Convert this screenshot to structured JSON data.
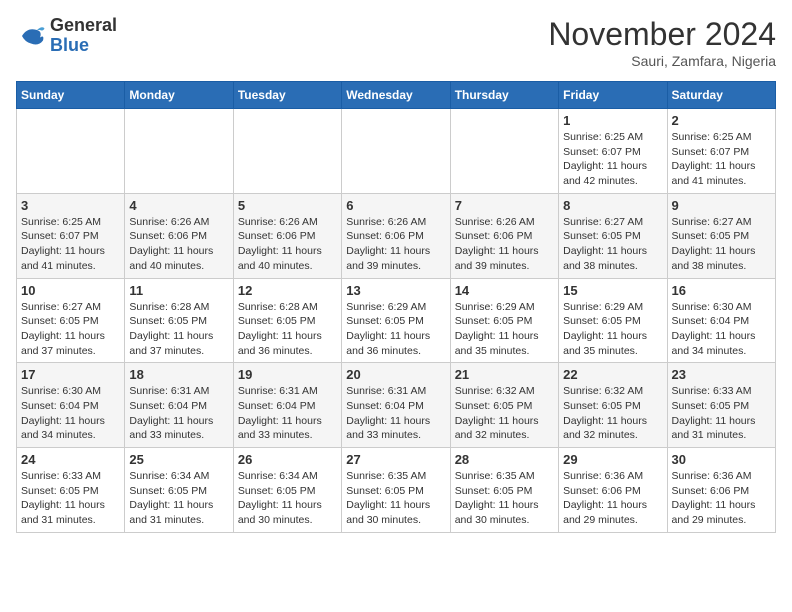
{
  "logo": {
    "general": "General",
    "blue": "Blue"
  },
  "title": {
    "month_year": "November 2024",
    "location": "Sauri, Zamfara, Nigeria"
  },
  "weekdays": [
    "Sunday",
    "Monday",
    "Tuesday",
    "Wednesday",
    "Thursday",
    "Friday",
    "Saturday"
  ],
  "weeks": [
    [
      {
        "day": "",
        "info": ""
      },
      {
        "day": "",
        "info": ""
      },
      {
        "day": "",
        "info": ""
      },
      {
        "day": "",
        "info": ""
      },
      {
        "day": "",
        "info": ""
      },
      {
        "day": "1",
        "info": "Sunrise: 6:25 AM\nSunset: 6:07 PM\nDaylight: 11 hours and 42 minutes."
      },
      {
        "day": "2",
        "info": "Sunrise: 6:25 AM\nSunset: 6:07 PM\nDaylight: 11 hours and 41 minutes."
      }
    ],
    [
      {
        "day": "3",
        "info": "Sunrise: 6:25 AM\nSunset: 6:07 PM\nDaylight: 11 hours and 41 minutes."
      },
      {
        "day": "4",
        "info": "Sunrise: 6:26 AM\nSunset: 6:06 PM\nDaylight: 11 hours and 40 minutes."
      },
      {
        "day": "5",
        "info": "Sunrise: 6:26 AM\nSunset: 6:06 PM\nDaylight: 11 hours and 40 minutes."
      },
      {
        "day": "6",
        "info": "Sunrise: 6:26 AM\nSunset: 6:06 PM\nDaylight: 11 hours and 39 minutes."
      },
      {
        "day": "7",
        "info": "Sunrise: 6:26 AM\nSunset: 6:06 PM\nDaylight: 11 hours and 39 minutes."
      },
      {
        "day": "8",
        "info": "Sunrise: 6:27 AM\nSunset: 6:05 PM\nDaylight: 11 hours and 38 minutes."
      },
      {
        "day": "9",
        "info": "Sunrise: 6:27 AM\nSunset: 6:05 PM\nDaylight: 11 hours and 38 minutes."
      }
    ],
    [
      {
        "day": "10",
        "info": "Sunrise: 6:27 AM\nSunset: 6:05 PM\nDaylight: 11 hours and 37 minutes."
      },
      {
        "day": "11",
        "info": "Sunrise: 6:28 AM\nSunset: 6:05 PM\nDaylight: 11 hours and 37 minutes."
      },
      {
        "day": "12",
        "info": "Sunrise: 6:28 AM\nSunset: 6:05 PM\nDaylight: 11 hours and 36 minutes."
      },
      {
        "day": "13",
        "info": "Sunrise: 6:29 AM\nSunset: 6:05 PM\nDaylight: 11 hours and 36 minutes."
      },
      {
        "day": "14",
        "info": "Sunrise: 6:29 AM\nSunset: 6:05 PM\nDaylight: 11 hours and 35 minutes."
      },
      {
        "day": "15",
        "info": "Sunrise: 6:29 AM\nSunset: 6:05 PM\nDaylight: 11 hours and 35 minutes."
      },
      {
        "day": "16",
        "info": "Sunrise: 6:30 AM\nSunset: 6:04 PM\nDaylight: 11 hours and 34 minutes."
      }
    ],
    [
      {
        "day": "17",
        "info": "Sunrise: 6:30 AM\nSunset: 6:04 PM\nDaylight: 11 hours and 34 minutes."
      },
      {
        "day": "18",
        "info": "Sunrise: 6:31 AM\nSunset: 6:04 PM\nDaylight: 11 hours and 33 minutes."
      },
      {
        "day": "19",
        "info": "Sunrise: 6:31 AM\nSunset: 6:04 PM\nDaylight: 11 hours and 33 minutes."
      },
      {
        "day": "20",
        "info": "Sunrise: 6:31 AM\nSunset: 6:04 PM\nDaylight: 11 hours and 33 minutes."
      },
      {
        "day": "21",
        "info": "Sunrise: 6:32 AM\nSunset: 6:05 PM\nDaylight: 11 hours and 32 minutes."
      },
      {
        "day": "22",
        "info": "Sunrise: 6:32 AM\nSunset: 6:05 PM\nDaylight: 11 hours and 32 minutes."
      },
      {
        "day": "23",
        "info": "Sunrise: 6:33 AM\nSunset: 6:05 PM\nDaylight: 11 hours and 31 minutes."
      }
    ],
    [
      {
        "day": "24",
        "info": "Sunrise: 6:33 AM\nSunset: 6:05 PM\nDaylight: 11 hours and 31 minutes."
      },
      {
        "day": "25",
        "info": "Sunrise: 6:34 AM\nSunset: 6:05 PM\nDaylight: 11 hours and 31 minutes."
      },
      {
        "day": "26",
        "info": "Sunrise: 6:34 AM\nSunset: 6:05 PM\nDaylight: 11 hours and 30 minutes."
      },
      {
        "day": "27",
        "info": "Sunrise: 6:35 AM\nSunset: 6:05 PM\nDaylight: 11 hours and 30 minutes."
      },
      {
        "day": "28",
        "info": "Sunrise: 6:35 AM\nSunset: 6:05 PM\nDaylight: 11 hours and 30 minutes."
      },
      {
        "day": "29",
        "info": "Sunrise: 6:36 AM\nSunset: 6:06 PM\nDaylight: 11 hours and 29 minutes."
      },
      {
        "day": "30",
        "info": "Sunrise: 6:36 AM\nSunset: 6:06 PM\nDaylight: 11 hours and 29 minutes."
      }
    ]
  ]
}
